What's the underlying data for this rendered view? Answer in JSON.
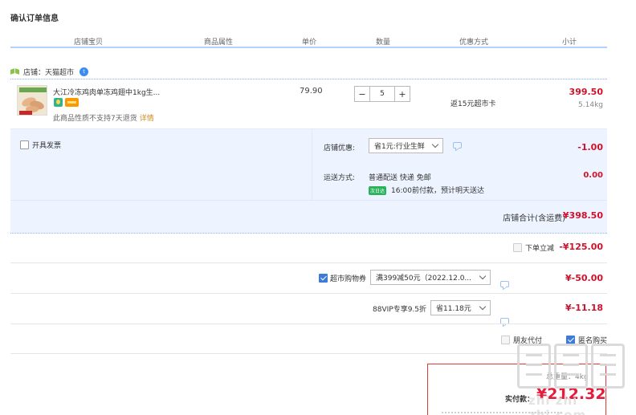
{
  "page_title": "确认订单信息",
  "columns": [
    "店铺宝贝",
    "商品属性",
    "单价",
    "数量",
    "优惠方式",
    "小计"
  ],
  "shop": {
    "label": "店铺：天猫超市",
    "badge": "t"
  },
  "item": {
    "title": "大江冷冻鸡肉单冻鸡翅中1kg生...",
    "note": "此商品性质不支持7天退货",
    "note_link": "详情",
    "unit_price": "79.90",
    "quantity": "5",
    "minus": "−",
    "plus": "+",
    "rebate": "返15元超市卡",
    "subtotal": "399.50",
    "weight": "5.14kg"
  },
  "invoice_label": "开具发票",
  "shop_discount": {
    "label": "店铺优惠:",
    "selected": "省1元:行业生鲜",
    "amount": "-1.00"
  },
  "shipping": {
    "label": "运送方式:",
    "method": "普通配送 快递 免邮",
    "tag": "次日达",
    "eta": "16:00前付款，预计明天送达",
    "amount": "0.00"
  },
  "shop_total": {
    "label": "店铺合计(含运费)",
    "amount": "¥398.50"
  },
  "instant_discount": {
    "label": "下单立减",
    "amount": "-¥125.00"
  },
  "supermarket_coupon": {
    "label": "超市购物券",
    "selected": "满399减50元（2022.12.0...",
    "amount": "¥-50.00"
  },
  "vip": {
    "label": "88VIP专享9.5折",
    "selected": "省11.18元",
    "amount": "¥-11.18"
  },
  "friend_pay_label": "朋友代付",
  "anonymous_label": "匿名购买",
  "pay": {
    "label": "实付款：",
    "amount": "¥212.32",
    "weight_ghost": "总重量：4kg"
  },
  "watermark": "zhi zhi zhi.com",
  "colors": {
    "accent_blue": "#3d7bd8",
    "price_red": "#d0112b",
    "panel_bg": "#eef4ff"
  }
}
